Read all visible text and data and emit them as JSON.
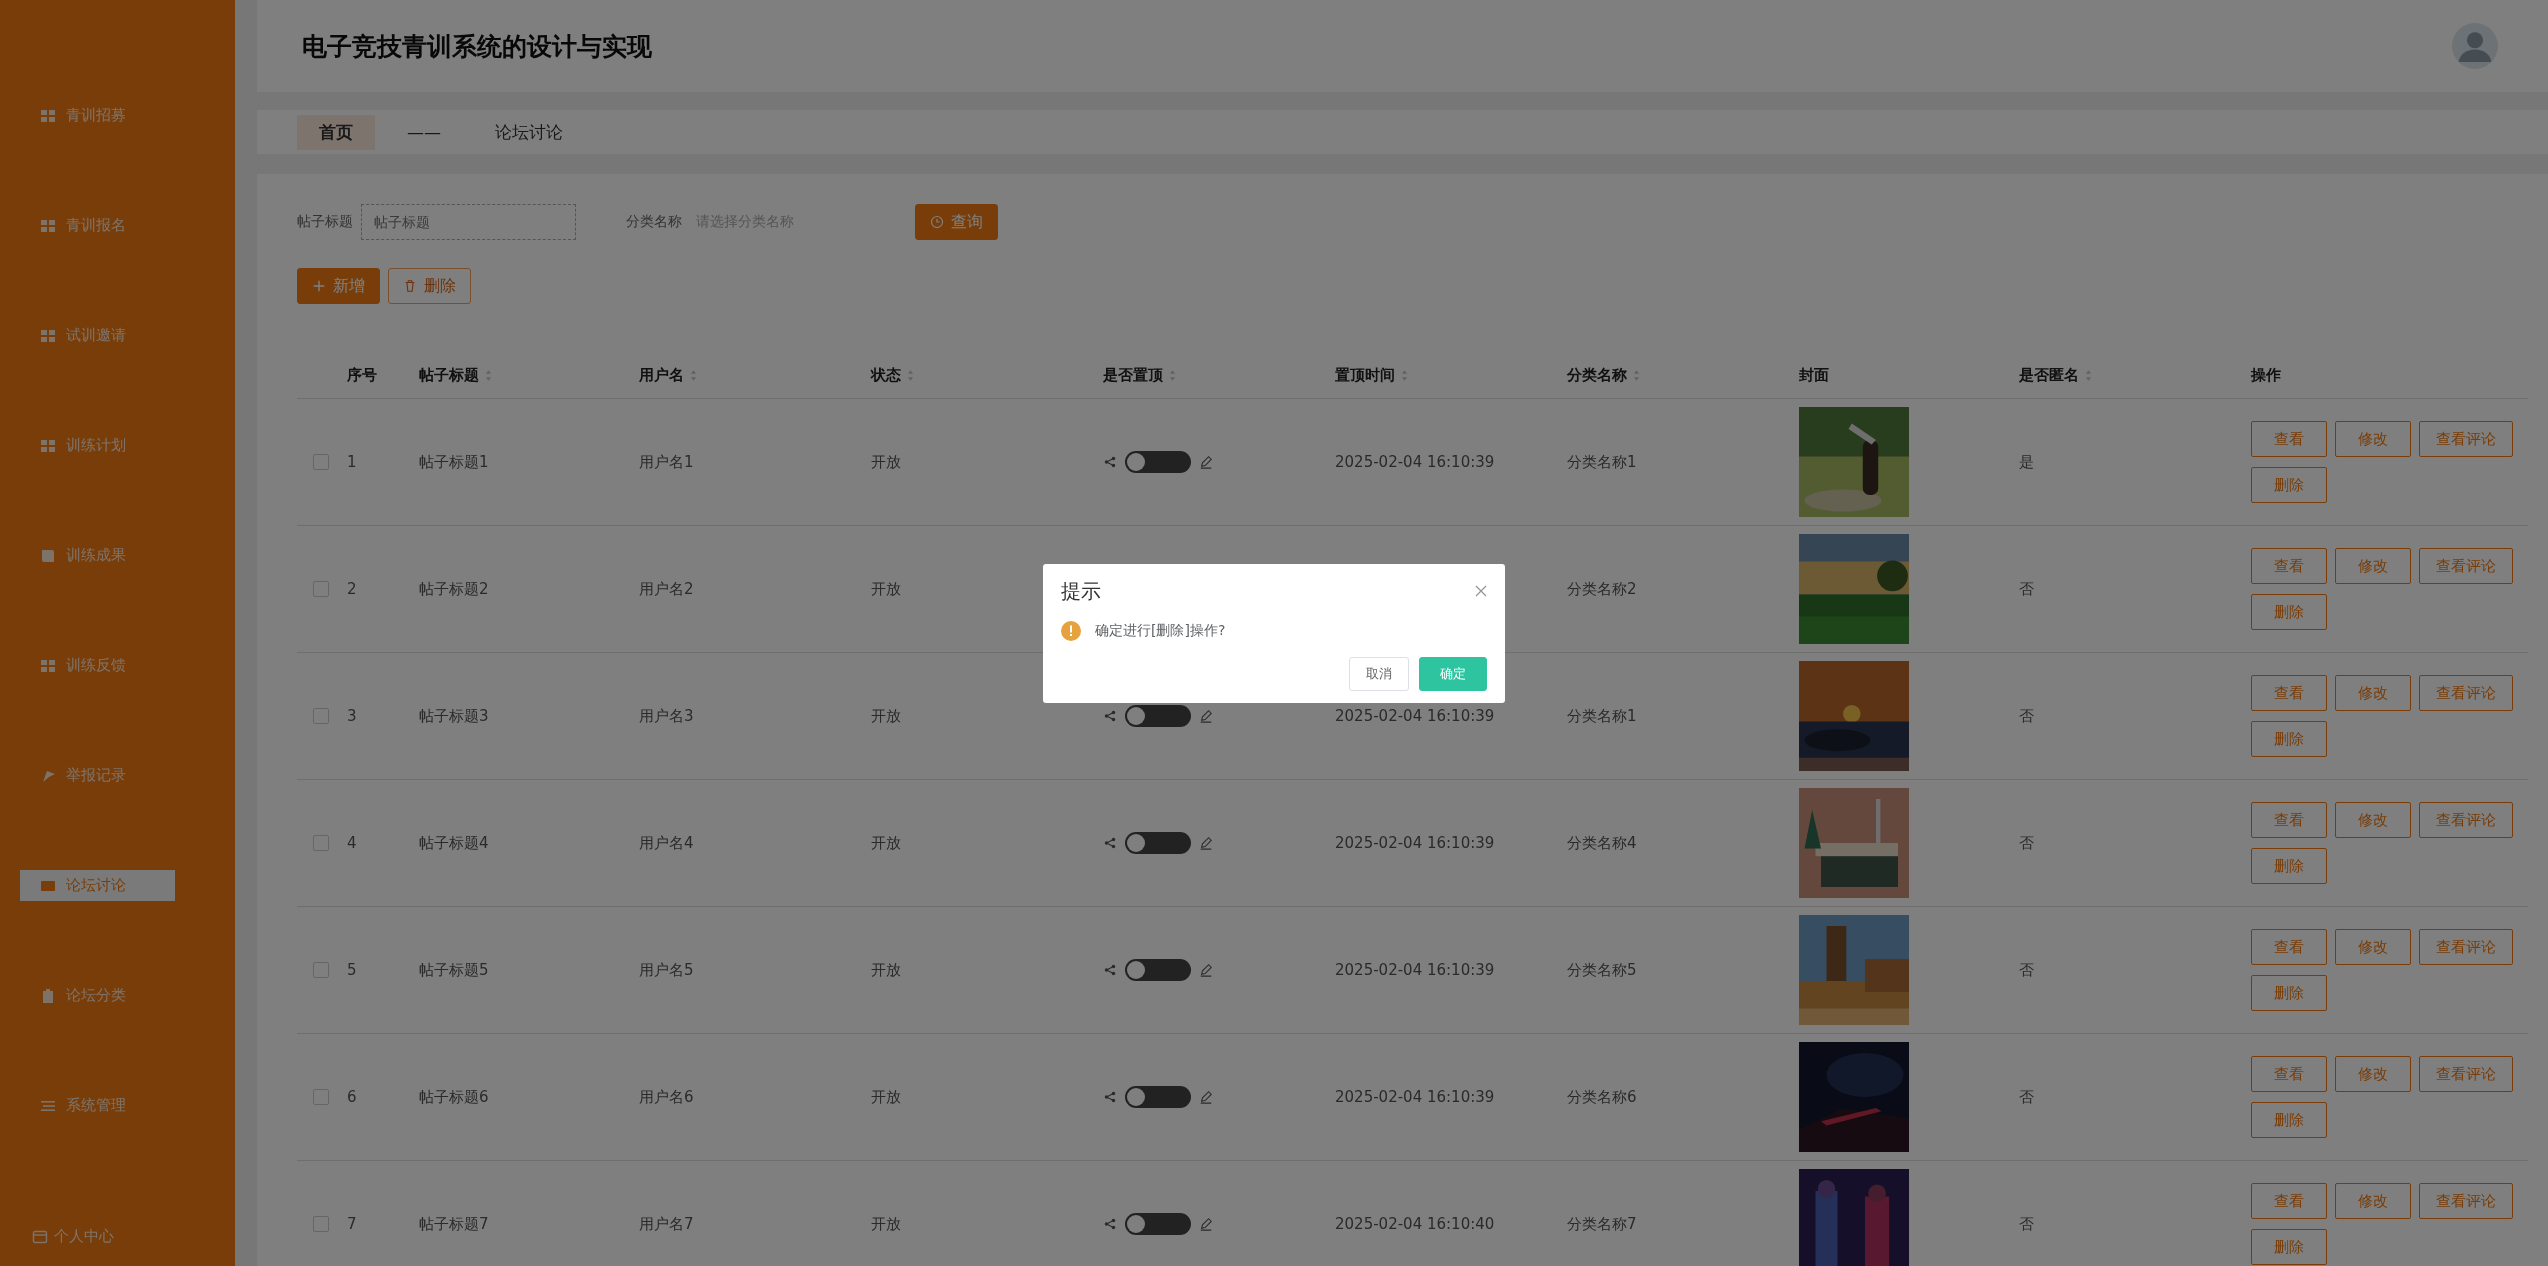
{
  "header": {
    "title": "电子竞技青训系统的设计与实现"
  },
  "sidebar": {
    "items": [
      {
        "label": "青训招募",
        "kind": "grid",
        "selected": false
      },
      {
        "label": "青训报名",
        "kind": "grid",
        "selected": false
      },
      {
        "label": "试训邀请",
        "kind": "grid",
        "selected": false
      },
      {
        "label": "训练计划",
        "kind": "grid",
        "selected": false
      },
      {
        "label": "训练成果",
        "kind": "book",
        "selected": false
      },
      {
        "label": "训练反馈",
        "kind": "grid",
        "selected": false
      },
      {
        "label": "举报记录",
        "kind": "flag",
        "selected": false
      },
      {
        "label": "论坛讨论",
        "kind": "card",
        "selected": true
      },
      {
        "label": "论坛分类",
        "kind": "clipboard",
        "selected": false
      },
      {
        "label": "系统管理",
        "kind": "list",
        "selected": false
      }
    ],
    "footer": {
      "label": "个人中心"
    }
  },
  "breadcrumb": {
    "items": [
      {
        "label": "首页",
        "selected": true
      },
      {
        "label": "论坛讨论",
        "selected": false
      }
    ],
    "separator": "——"
  },
  "search": {
    "fields": [
      {
        "label": "帖子标题",
        "placeholder": "帖子标题",
        "kind": "input"
      },
      {
        "label": "分类名称",
        "placeholder": "请选择分类名称",
        "kind": "select"
      }
    ],
    "button": "查询"
  },
  "actions": [
    {
      "label": "新增",
      "kind": "add"
    },
    {
      "label": "删除",
      "kind": "delete"
    }
  ],
  "table": {
    "columns": [
      {
        "label": "序号",
        "sortable": false
      },
      {
        "label": "帖子标题",
        "sortable": true
      },
      {
        "label": "用户名",
        "sortable": true
      },
      {
        "label": "状态",
        "sortable": true
      },
      {
        "label": "是否置顶",
        "sortable": true
      },
      {
        "label": "置顶时间",
        "sortable": true
      },
      {
        "label": "分类名称",
        "sortable": true
      },
      {
        "label": "封面",
        "sortable": false
      },
      {
        "label": "是否匿名",
        "sortable": true
      },
      {
        "label": "操作",
        "sortable": false
      }
    ],
    "rows": [
      {
        "checked": false,
        "index": "1",
        "title": "帖子标题1",
        "user": "用户名1",
        "status": "开放",
        "pinned": false,
        "pinned_time": "2025-02-04 16:10:39",
        "category": "分类名称1",
        "anonymous": "是",
        "actions": [
          "查看",
          "修改",
          "查看评论",
          "删除"
        ]
      },
      {
        "checked": false,
        "index": "2",
        "title": "帖子标题2",
        "user": "用户名2",
        "status": "开放",
        "category": "分类名称2",
        "anonymous": "否",
        "actions": [
          "查看",
          "修改",
          "查看评论",
          "删除"
        ]
      },
      {
        "checked": false,
        "index": "3",
        "title": "帖子标题3",
        "user": "用户名3",
        "status": "开放",
        "pinned": false,
        "pinned_time": "2025-02-04 16:10:39",
        "category": "分类名称1",
        "anonymous": "否",
        "actions": [
          "查看",
          "修改",
          "查看评论",
          "删除"
        ]
      },
      {
        "checked": false,
        "index": "4",
        "title": "帖子标题4",
        "user": "用户名4",
        "status": "开放",
        "pinned": false,
        "pinned_time": "2025-02-04 16:10:39",
        "category": "分类名称4",
        "anonymous": "否",
        "actions": [
          "查看",
          "修改",
          "查看评论",
          "删除"
        ]
      },
      {
        "checked": false,
        "index": "5",
        "title": "帖子标题5",
        "user": "用户名5",
        "status": "开放",
        "pinned": false,
        "pinned_time": "2025-02-04 16:10:39",
        "category": "分类名称5",
        "anonymous": "否",
        "actions": [
          "查看",
          "修改",
          "查看评论",
          "删除"
        ]
      },
      {
        "checked": false,
        "index": "6",
        "title": "帖子标题6",
        "user": "用户名6",
        "status": "开放",
        "pinned": false,
        "pinned_time": "2025-02-04 16:10:39",
        "category": "分类名称6",
        "anonymous": "否",
        "actions": [
          "查看",
          "修改",
          "查看评论",
          "删除"
        ]
      },
      {
        "checked": false,
        "index": "7",
        "title": "帖子标题7",
        "user": "用户名7",
        "status": "开放",
        "pinned": false,
        "pinned_time": "2025-02-04 16:10:40",
        "category": "分类名称7",
        "anonymous": "否",
        "actions": [
          "查看",
          "修改",
          "查看评论",
          "删除"
        ]
      }
    ]
  },
  "dialog": {
    "title": "提示",
    "message": "确定进行[删除]操作?",
    "buttons": [
      {
        "label": "取消",
        "kind": "cancel"
      },
      {
        "label": "确定",
        "kind": "confirm"
      }
    ]
  }
}
